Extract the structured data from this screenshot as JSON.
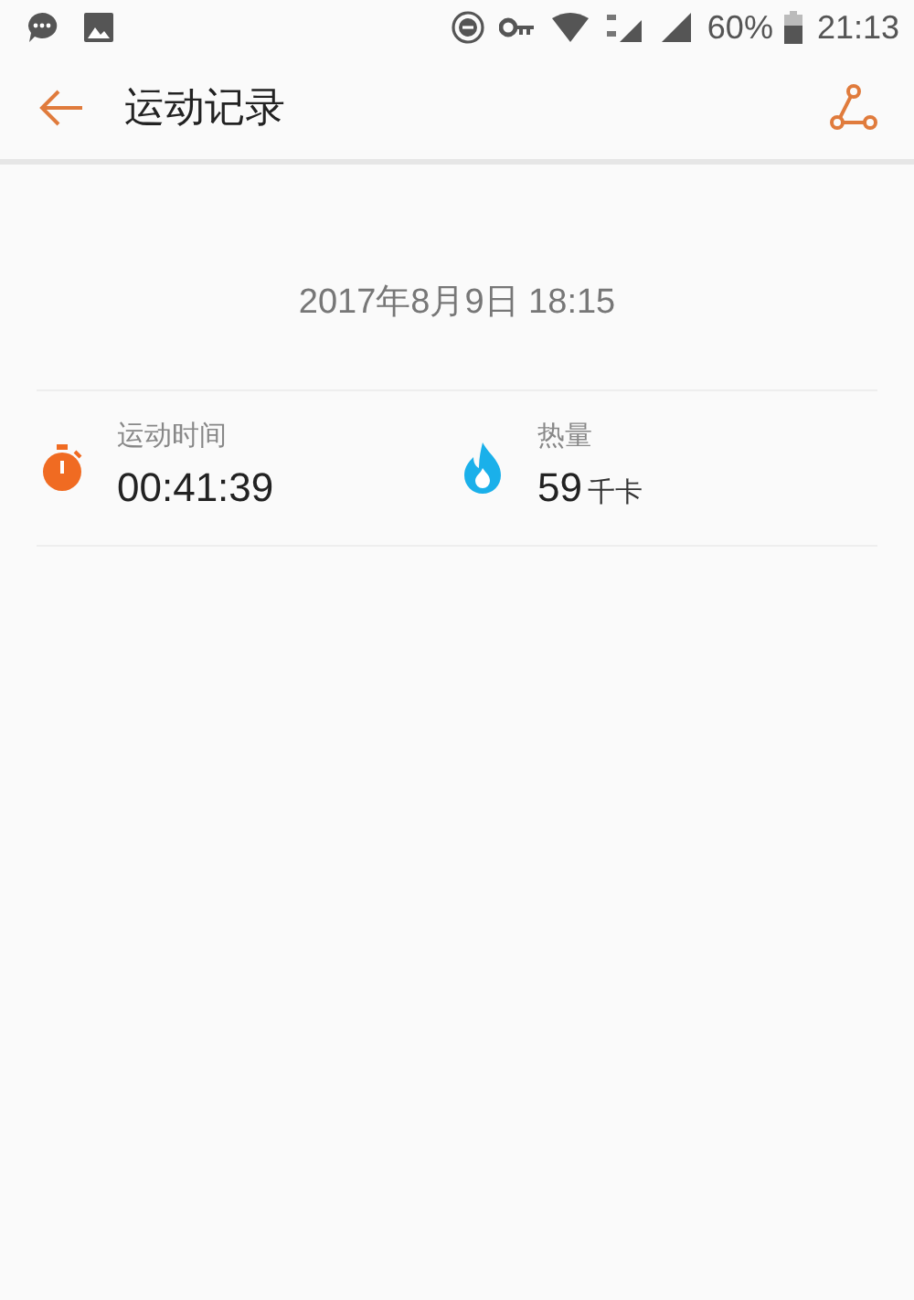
{
  "status_bar": {
    "battery": "60%",
    "time": "21:13"
  },
  "app_bar": {
    "title": "运动记录"
  },
  "record": {
    "date": "2017年8月9日 18:15",
    "stats": [
      {
        "kind": "duration",
        "label": "运动时间",
        "value": "00:41:39"
      },
      {
        "kind": "calories",
        "label": "热量",
        "value": "59",
        "unit": "千卡"
      }
    ]
  }
}
